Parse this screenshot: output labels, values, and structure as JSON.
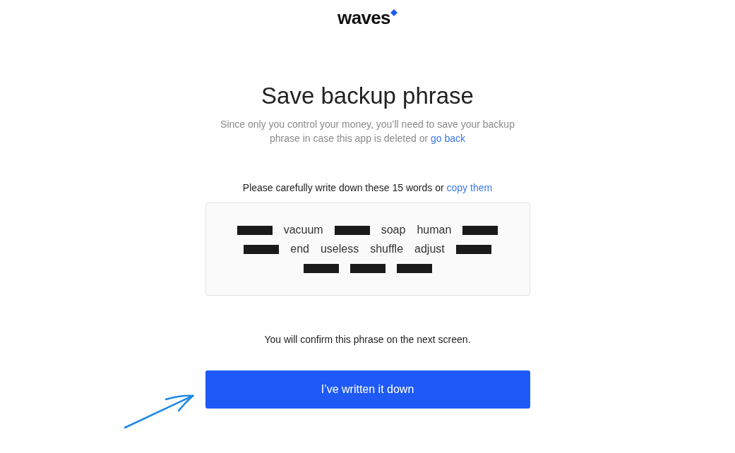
{
  "logo": {
    "text": "waves"
  },
  "title": "Save backup phrase",
  "subtitle": {
    "text": "Since only you control your money, you’ll need to save your backup phrase in case this app is deleted or",
    "link": "go back"
  },
  "instruction": {
    "text": "Please carefully write down these 15 words or",
    "link": "copy them"
  },
  "words": [
    {
      "redacted": true
    },
    {
      "text": "vacuum",
      "redacted": false
    },
    {
      "redacted": true
    },
    {
      "text": "soap",
      "redacted": false
    },
    {
      "text": "human",
      "redacted": false
    },
    {
      "redacted": true
    },
    {
      "redacted": true
    },
    {
      "text": "end",
      "redacted": false
    },
    {
      "text": "useless",
      "redacted": false
    },
    {
      "text": "shuffle",
      "redacted": false
    },
    {
      "text": "adjust",
      "redacted": false
    },
    {
      "redacted": true
    },
    {
      "redacted": true
    },
    {
      "redacted": true
    },
    {
      "redacted": true
    }
  ],
  "note": "You will confirm this phrase on the next screen.",
  "button": "I’ve written it down"
}
